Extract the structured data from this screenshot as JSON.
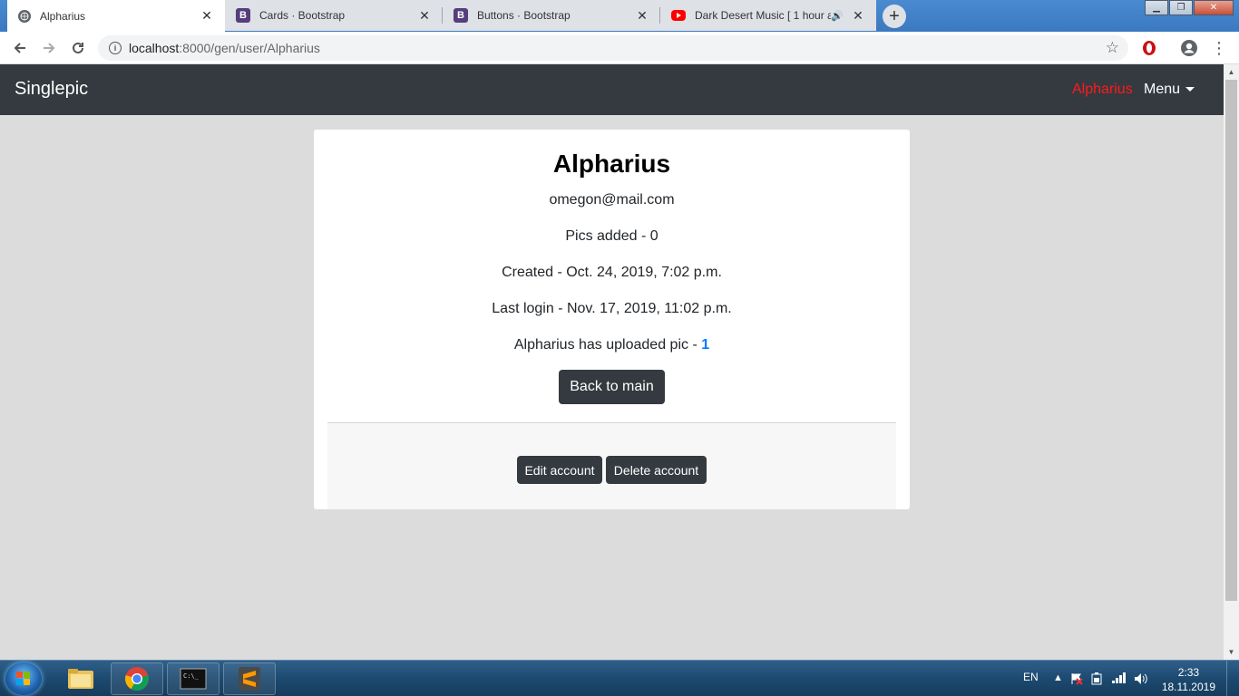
{
  "browser": {
    "tabs": [
      {
        "title": "Alpharius",
        "active": true,
        "icon": "globe-icon"
      },
      {
        "title": "Cards · Bootstrap",
        "active": false,
        "icon": "bootstrap-icon"
      },
      {
        "title": "Buttons · Bootstrap",
        "active": false,
        "icon": "bootstrap-icon"
      },
      {
        "title": "Dark Desert Music [ 1 hour a",
        "active": false,
        "icon": "youtube-icon"
      }
    ],
    "url_host": "localhost",
    "url_path": ":8000/gen/user/Alpharius",
    "colors": {
      "bootstrap": "#563d7c",
      "youtube": "#ff0000",
      "opera": "#cc0f16"
    }
  },
  "navbar": {
    "brand": "Singlepic",
    "user": "Alpharius",
    "menu": "Menu"
  },
  "profile": {
    "username": "Alpharius",
    "email": "omegon@mail.com",
    "pics_added": "Pics added - 0",
    "created": "Created - Oct. 24, 2019, 7:02 p.m.",
    "last_login": "Last login - Nov. 17, 2019, 11:02 p.m.",
    "uploaded_prefix": "Alpharius has uploaded pic - ",
    "uploaded_link": "1",
    "back_button": "Back to main",
    "edit_button": "Edit account",
    "delete_button": "Delete account"
  },
  "taskbar": {
    "language": "EN",
    "time": "2:33",
    "date": "18.11.2019",
    "apps": [
      "file-explorer-icon",
      "chrome-icon",
      "terminal-icon",
      "sublime-text-icon"
    ]
  }
}
